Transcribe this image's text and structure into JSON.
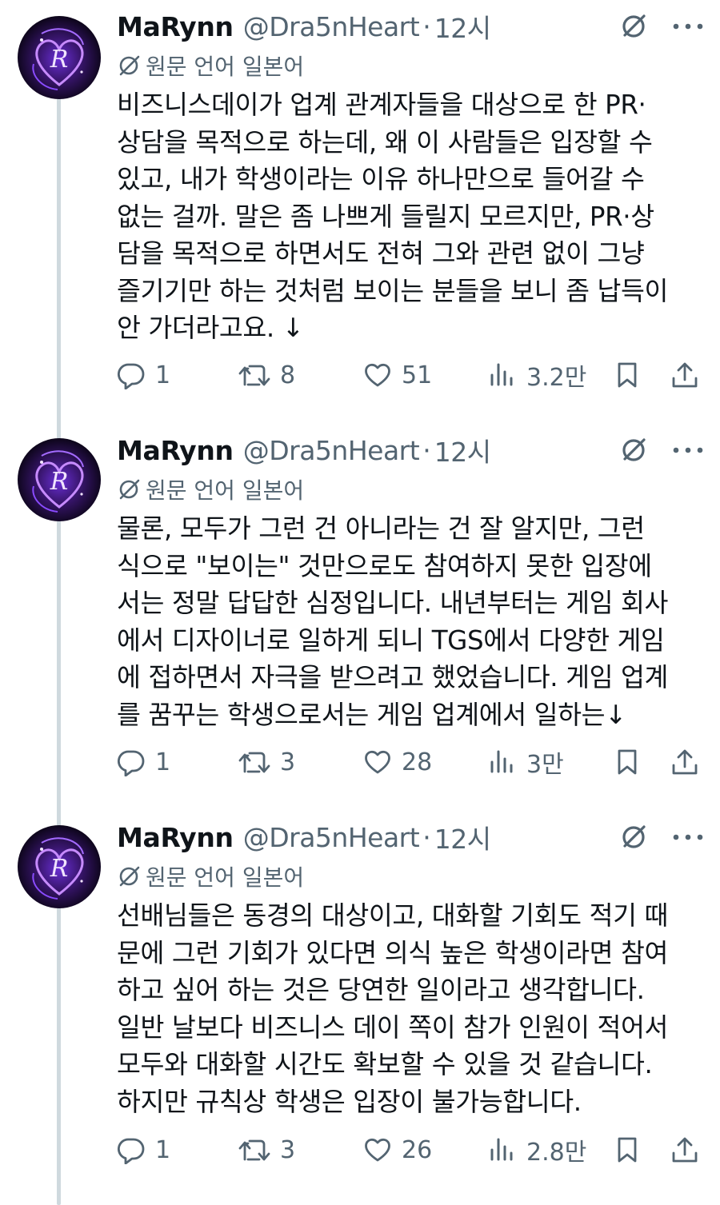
{
  "tweets": [
    {
      "name": "MaRynn",
      "handle": "@Dra5nHeart",
      "separator": "·",
      "time": "12시",
      "translate_label": "원문 언어 일본어",
      "lines": [
        "비즈니스데이가 업계 관계자들을 대상으로 한 PR·",
        "상담을 목적으로 하는데, 왜 이 사람들은 입장할 수",
        "있고, 내가 학생이라는 이유 하나만으로 들어갈 수",
        "없는 걸까. 말은 좀 나쁘게 들릴지 모르지만, PR·상",
        "담을 목적으로 하면서도 전혀 그와 관련 없이 그냥",
        "즐기기만 하는 것처럼 보이는 분들을 보니 좀 납득이",
        "안 가더라고요. ↓"
      ],
      "replies": "1",
      "reposts": "8",
      "likes": "51",
      "views": "3.2만"
    },
    {
      "name": "MaRynn",
      "handle": "@Dra5nHeart",
      "separator": "·",
      "time": "12시",
      "translate_label": "원문 언어 일본어",
      "lines": [
        "물론, 모두가 그런 건 아니라는 건 잘 알지만, 그런",
        "식으로 \"보이는\" 것만으로도 참여하지 못한 입장에",
        "서는 정말 답답한 심정입니다. 내년부터는 게임 회사",
        "에서 디자이너로 일하게 되니 TGS에서 다양한 게임",
        "에 접하면서 자극을 받으려고 했었습니다. 게임 업계",
        "를 꿈꾸는 학생으로서는 게임 업계에서 일하는↓"
      ],
      "replies": "1",
      "reposts": "3",
      "likes": "28",
      "views": "3만"
    },
    {
      "name": "MaRynn",
      "handle": "@Dra5nHeart",
      "separator": "·",
      "time": "12시",
      "translate_label": "원문 언어 일본어",
      "lines": [
        "선배님들은 동경의 대상이고, 대화할 기회도 적기 때",
        "문에 그런 기회가 있다면 의식 높은 학생이라면 참여",
        "하고 싶어 하는 것은 당연한 일이라고 생각합니다.",
        "일반 날보다 비즈니스 데이 쪽이 참가 인원이 적어서",
        "모두와 대화할 시간도 확보할 수 있을 것 같습니다.",
        "하지만 규칙상 학생은 입장이 불가능합니다."
      ],
      "replies": "1",
      "reposts": "3",
      "likes": "26",
      "views": "2.8만"
    }
  ],
  "icons": {
    "grok": "grok-slash-circle-icon",
    "more": "more-dots-icon",
    "translate": "translate-globe-icon",
    "reply": "reply-bubble-icon",
    "repost": "repost-arrows-icon",
    "like": "heart-icon",
    "views": "views-bars-icon",
    "bookmark": "bookmark-icon",
    "share": "share-upload-icon"
  },
  "colors": {
    "text": "#0f1419",
    "muted": "#536471",
    "thread_line": "#cfd9de",
    "avatar_accent": "#9b4dff"
  }
}
